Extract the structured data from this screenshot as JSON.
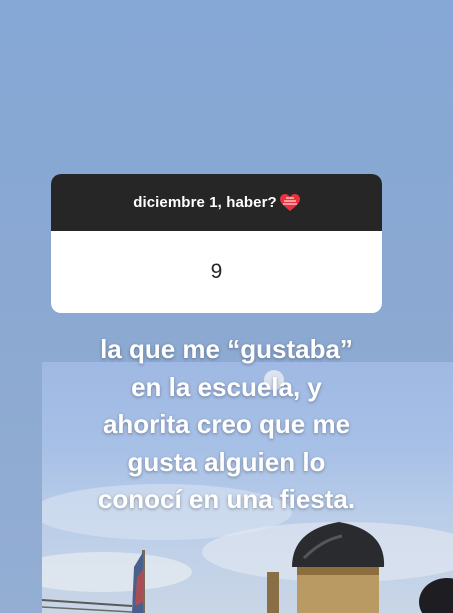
{
  "question_card": {
    "question": "diciembre 1, haber?",
    "answer": "9",
    "heart_icon": "heart-emoji-icon"
  },
  "caption": {
    "lines": [
      "la que me “gustaba”",
      "en la escuela, y",
      "ahorita creo que me",
      "gusta alguien lo",
      "conocí en una fiesta."
    ]
  },
  "colors": {
    "background": "#86a8d6",
    "card_header": "#262626",
    "card_body": "#ffffff",
    "caption_text": "#ffffff"
  }
}
